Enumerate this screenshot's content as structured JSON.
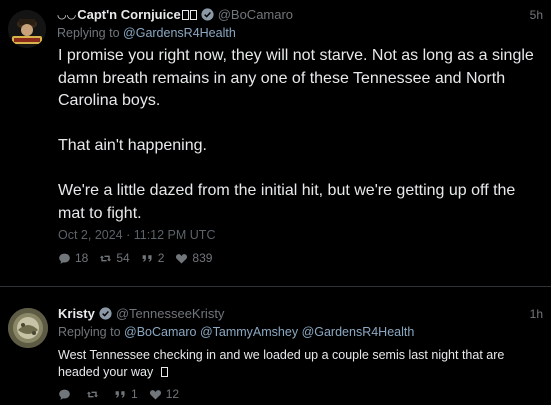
{
  "posts": [
    {
      "author_name": "Capt'n Cornjuice",
      "handle": "@BoCamaro",
      "time": "5h",
      "replying_label": "Replying to",
      "replying_to": "@GardensR4Health",
      "paragraphs": [
        "I promise you right now, they will not starve. Not as long as a single damn breath remains in any one of these Tennessee and North Carolina boys.",
        "That ain't happening.",
        "We're a little dazed from the initial hit, but we're getting up off the mat to fight."
      ],
      "timestamp": "Oct 2, 2024 · 11:12 PM UTC",
      "stats": {
        "replies": "18",
        "retweets": "54",
        "quotes": "2",
        "likes": "839"
      },
      "avatar_text": "Captn Cornjuice"
    },
    {
      "author_name": "Kristy",
      "handle": "@TennesseeKristy",
      "time": "1h",
      "replying_label": "Replying to",
      "replying_to": [
        "@BoCamaro",
        "@TammyAmshey",
        "@GardensR4Health"
      ],
      "text": "West Tennessee checking in and we loaded up a couple semis last night that are headed your way",
      "stats": {
        "replies": "",
        "retweets": "",
        "quotes": "1",
        "likes": "12"
      }
    }
  ],
  "colors": {
    "background": "#000000",
    "text": "#e7e9ea",
    "muted": "#71767b",
    "mention": "#8ba8c2",
    "divider": "#2f3336",
    "verified": "#8b98a5"
  },
  "icons": {
    "verified": "check-circle-icon",
    "reply": "comment-icon",
    "retweet": "retweet-icon",
    "quote": "quote-icon",
    "like": "heart-icon"
  }
}
